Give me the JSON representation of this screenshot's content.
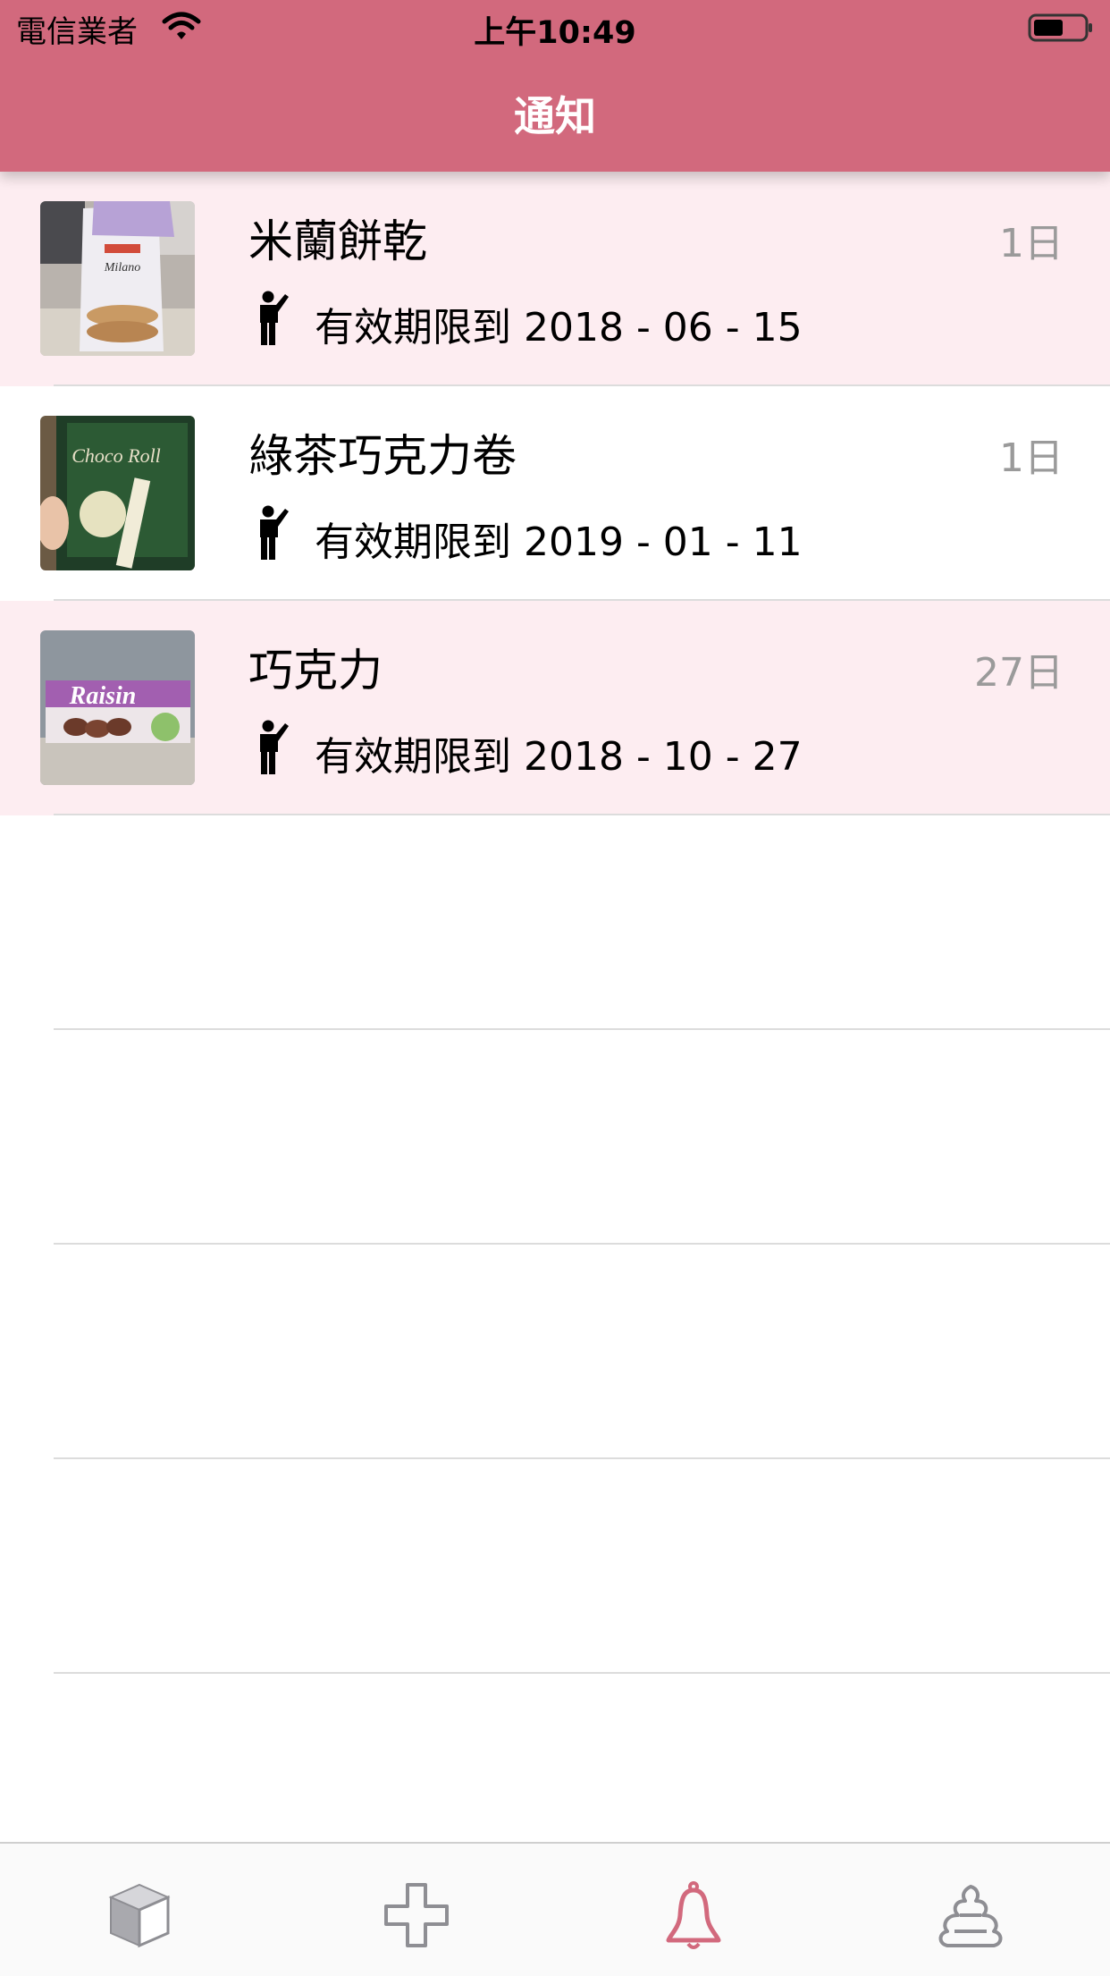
{
  "status_bar": {
    "carrier": "電信業者",
    "time": "上午10:49",
    "wifi_icon": "wifi-icon",
    "battery_icon": "battery-icon"
  },
  "header": {
    "title": "通知"
  },
  "colors": {
    "header_bg": "#d2697d",
    "row_highlight": "#fdedf1",
    "tab_active": "#d2697d",
    "tab_inactive": "#8e8e93"
  },
  "items": [
    {
      "name": "米蘭餅乾",
      "expiry": "有效期限到 2018 - 06 - 15",
      "days": "1日",
      "highlighted": true,
      "thumbnail": "milano-cookies-photo"
    },
    {
      "name": "綠茶巧克力卷",
      "expiry": "有效期限到 2019 - 01 - 11",
      "days": "1日",
      "highlighted": false,
      "thumbnail": "choco-roll-photo"
    },
    {
      "name": "巧克力",
      "expiry": "有效期限到 2018 - 10 - 27",
      "days": "27日",
      "highlighted": true,
      "thumbnail": "raisin-chocolate-photo"
    }
  ],
  "tabbar": {
    "tabs": [
      {
        "icon": "box-icon",
        "active": false
      },
      {
        "icon": "plus-icon",
        "active": false
      },
      {
        "icon": "bell-icon",
        "active": true
      },
      {
        "icon": "poop-icon",
        "active": false
      }
    ]
  }
}
